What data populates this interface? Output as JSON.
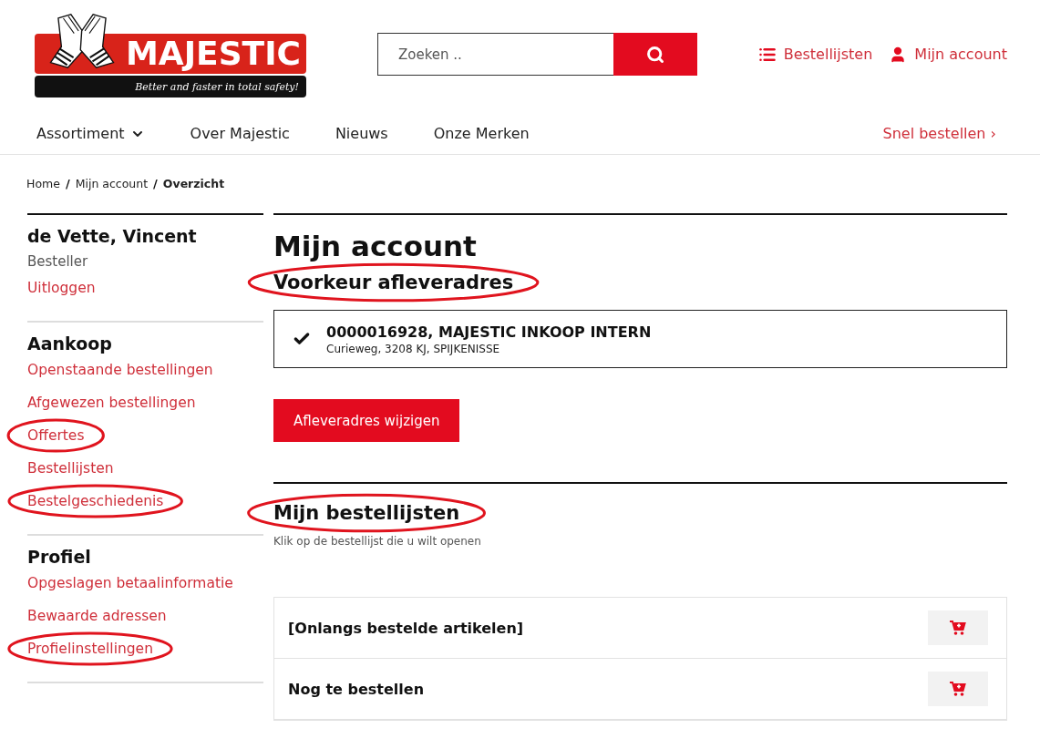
{
  "header": {
    "logo": {
      "name": "MAJESTIC",
      "tagline": "Better and faster in total safety!"
    },
    "search": {
      "placeholder": "Zoeken .."
    },
    "links": [
      {
        "kind": "lists",
        "label": "Bestellijsten"
      },
      {
        "kind": "account",
        "label": "Mijn account"
      }
    ]
  },
  "nav": {
    "items": [
      {
        "label": "Assortiment",
        "dropdown": true
      },
      {
        "label": "Over Majestic",
        "dropdown": false
      },
      {
        "label": "Nieuws",
        "dropdown": false
      },
      {
        "label": "Onze Merken",
        "dropdown": false
      }
    ],
    "quick_order": {
      "label": "Snel bestellen",
      "arrow": "›"
    }
  },
  "breadcrumb": [
    {
      "label": "Home",
      "current": false
    },
    {
      "label": "Mijn account",
      "current": false
    },
    {
      "label": "Overzicht",
      "current": true
    }
  ],
  "breadcrumb_separator": "/",
  "sidebar": {
    "user": {
      "name": "de Vette, Vincent",
      "role": "Besteller",
      "logout": "Uitloggen"
    },
    "sections": [
      {
        "title": "Aankoop",
        "items": [
          {
            "label": "Openstaande bestellingen",
            "circled": false
          },
          {
            "label": "Afgewezen bestellingen",
            "circled": false
          },
          {
            "label": "Offertes",
            "circled": true
          },
          {
            "label": "Bestellijsten",
            "circled": false
          },
          {
            "label": "Bestelgeschiedenis",
            "circled": true
          }
        ]
      },
      {
        "title": "Profiel",
        "items": [
          {
            "label": "Opgeslagen betaalinformatie",
            "circled": false
          },
          {
            "label": "Bewaarde adressen",
            "circled": false
          },
          {
            "label": "Profielinstellingen",
            "circled": true
          }
        ]
      }
    ]
  },
  "main": {
    "title": "Mijn account",
    "delivery": {
      "heading": "Voorkeur afleveradres",
      "circled": true,
      "address": {
        "selected": true,
        "title": "0000016928, MAJESTIC INKOOP INTERN",
        "detail": "Curieweg, 3208 KJ, SPIJKENISSE"
      },
      "button": "Afleveradres wijzigen"
    },
    "lists": {
      "heading": "Mijn bestellijsten",
      "circled": true,
      "subtitle": "Klik op de bestellijst die u wilt openen",
      "rows": [
        {
          "name": "[Onlangs bestelde artikelen]"
        },
        {
          "name": "Nog te bestellen"
        }
      ]
    }
  }
}
